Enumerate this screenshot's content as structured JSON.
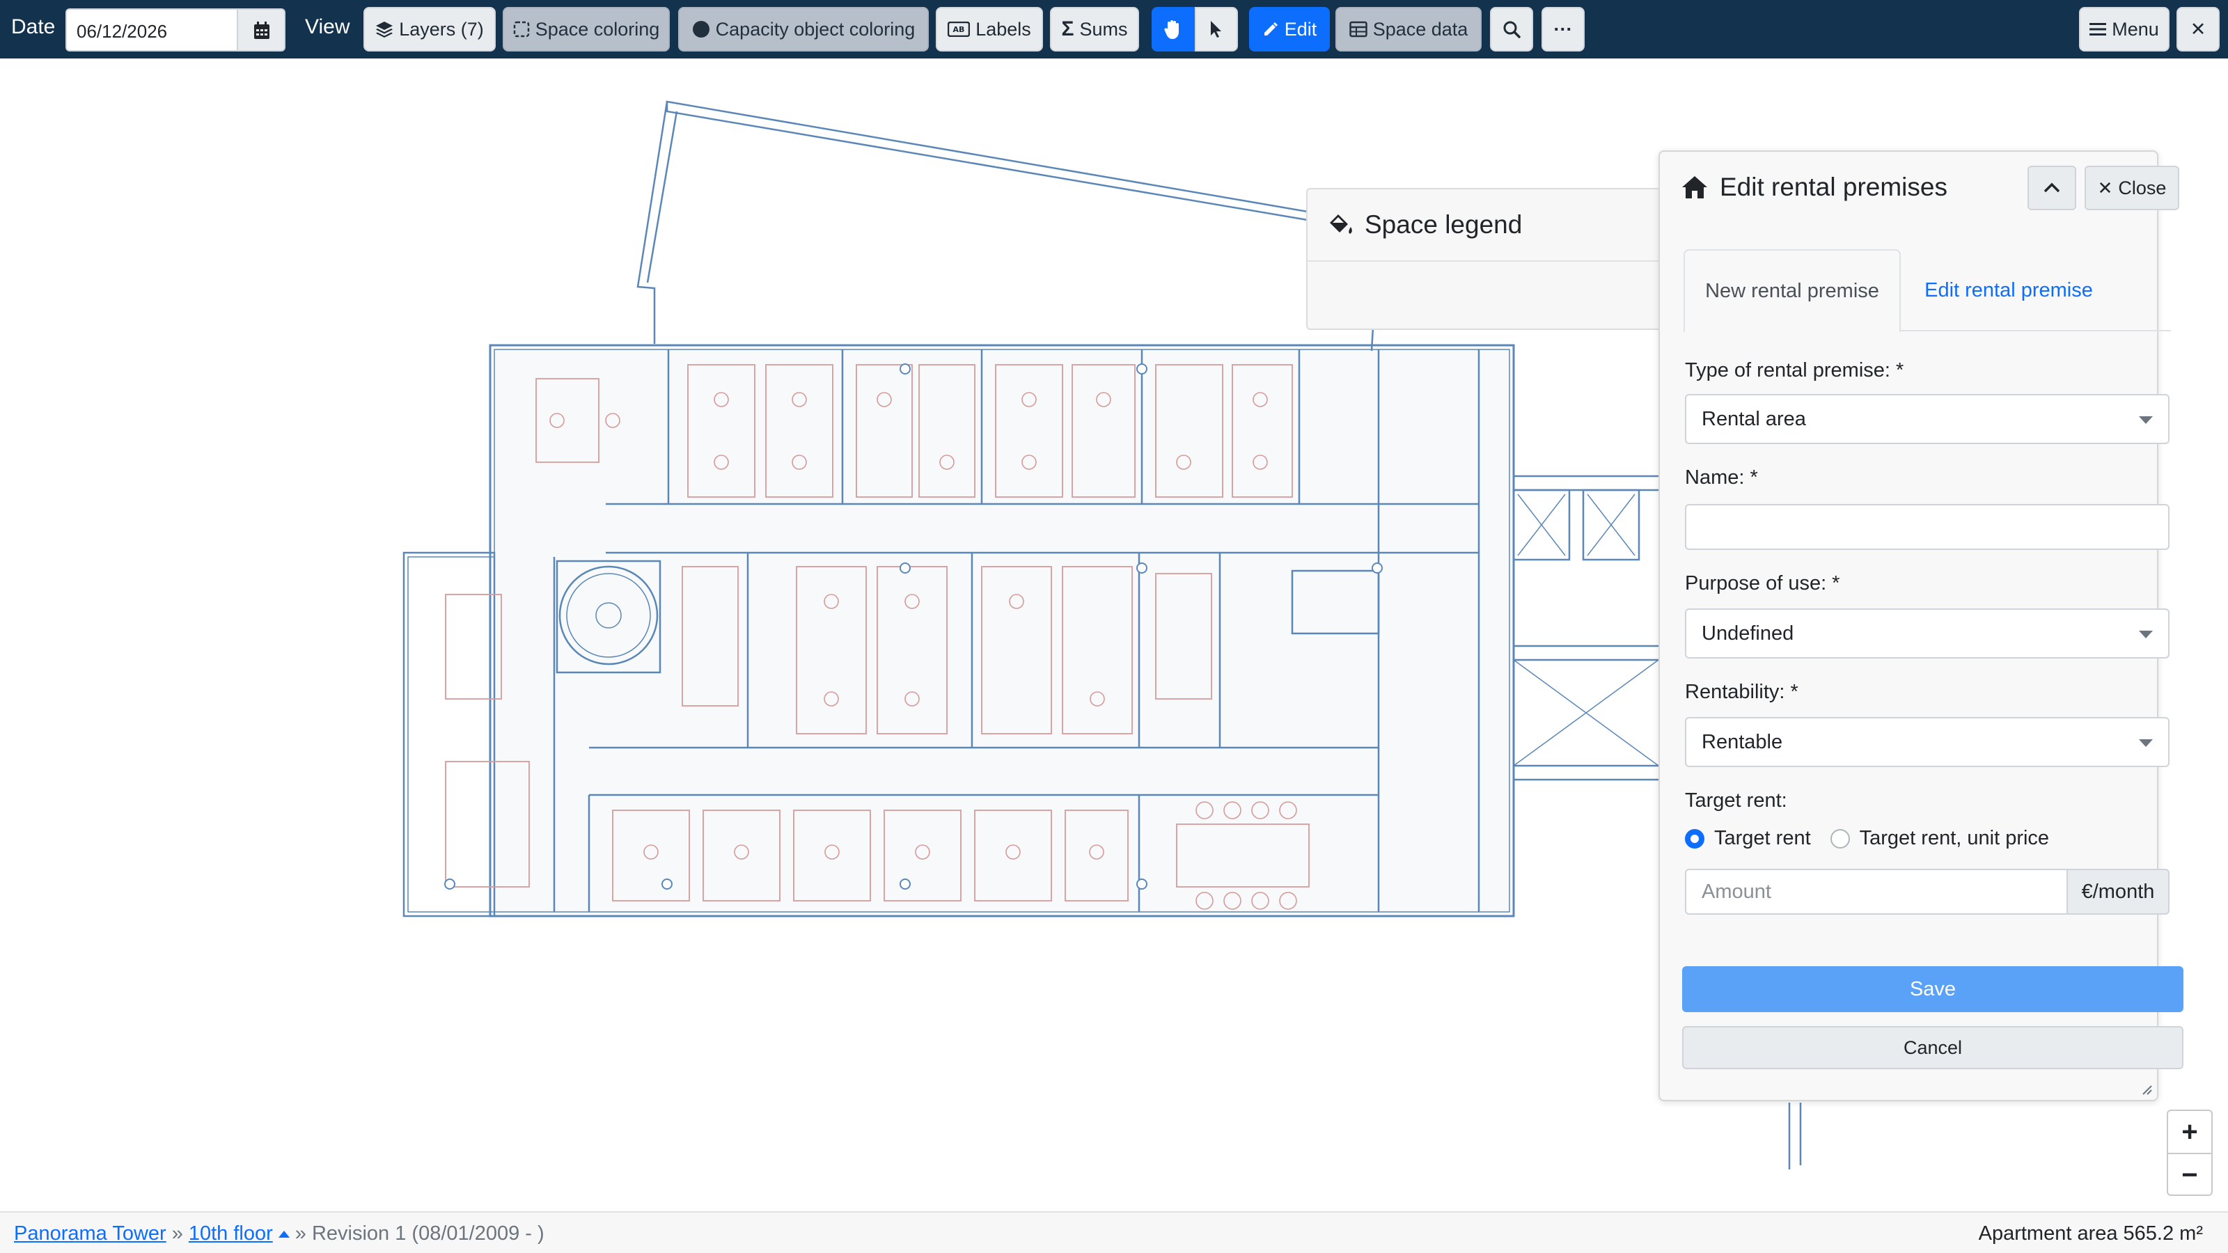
{
  "toolbar": {
    "date_label": "Date",
    "date_value": "06/12/2026",
    "view_label": "View",
    "layers": "Layers (7)",
    "space_coloring": "Space coloring",
    "capacity_coloring": "Capacity object coloring",
    "labels": "Labels",
    "sums": "Sums",
    "edit": "Edit",
    "space_data": "Space data",
    "more": "···",
    "menu": "Menu",
    "close": "✕"
  },
  "legend": {
    "title": "Space legend"
  },
  "panel": {
    "title": "Edit rental premises",
    "close": "Close",
    "tabs": [
      {
        "label": "New rental premise",
        "active": true
      },
      {
        "label": "Edit rental premise",
        "active": false
      }
    ],
    "type_label": "Type of rental premise: *",
    "type_value": "Rental area",
    "name_label": "Name: *",
    "purpose_label": "Purpose of use: *",
    "purpose_value": "Undefined",
    "rentability_label": "Rentability: *",
    "rentability_value": "Rentable",
    "target_rent_label": "Target rent:",
    "radio_target_rent": "Target rent",
    "radio_unit_price": "Target rent, unit price",
    "amount_placeholder": "Amount",
    "unit": "€/month",
    "save": "Save",
    "cancel": "Cancel"
  },
  "zoom": {
    "in": "+",
    "out": "−"
  },
  "status": {
    "building": "Panorama Tower",
    "sep": "»",
    "floor": "10th floor",
    "revision": "» Revision 1 (08/01/2009 - )",
    "area": "Apartment area 565.2 m²"
  },
  "colors": {
    "toolbar_bg": "#13324d",
    "accent": "#0d6efd",
    "wall": "#5b87b8",
    "furniture": "#d79a9a"
  }
}
